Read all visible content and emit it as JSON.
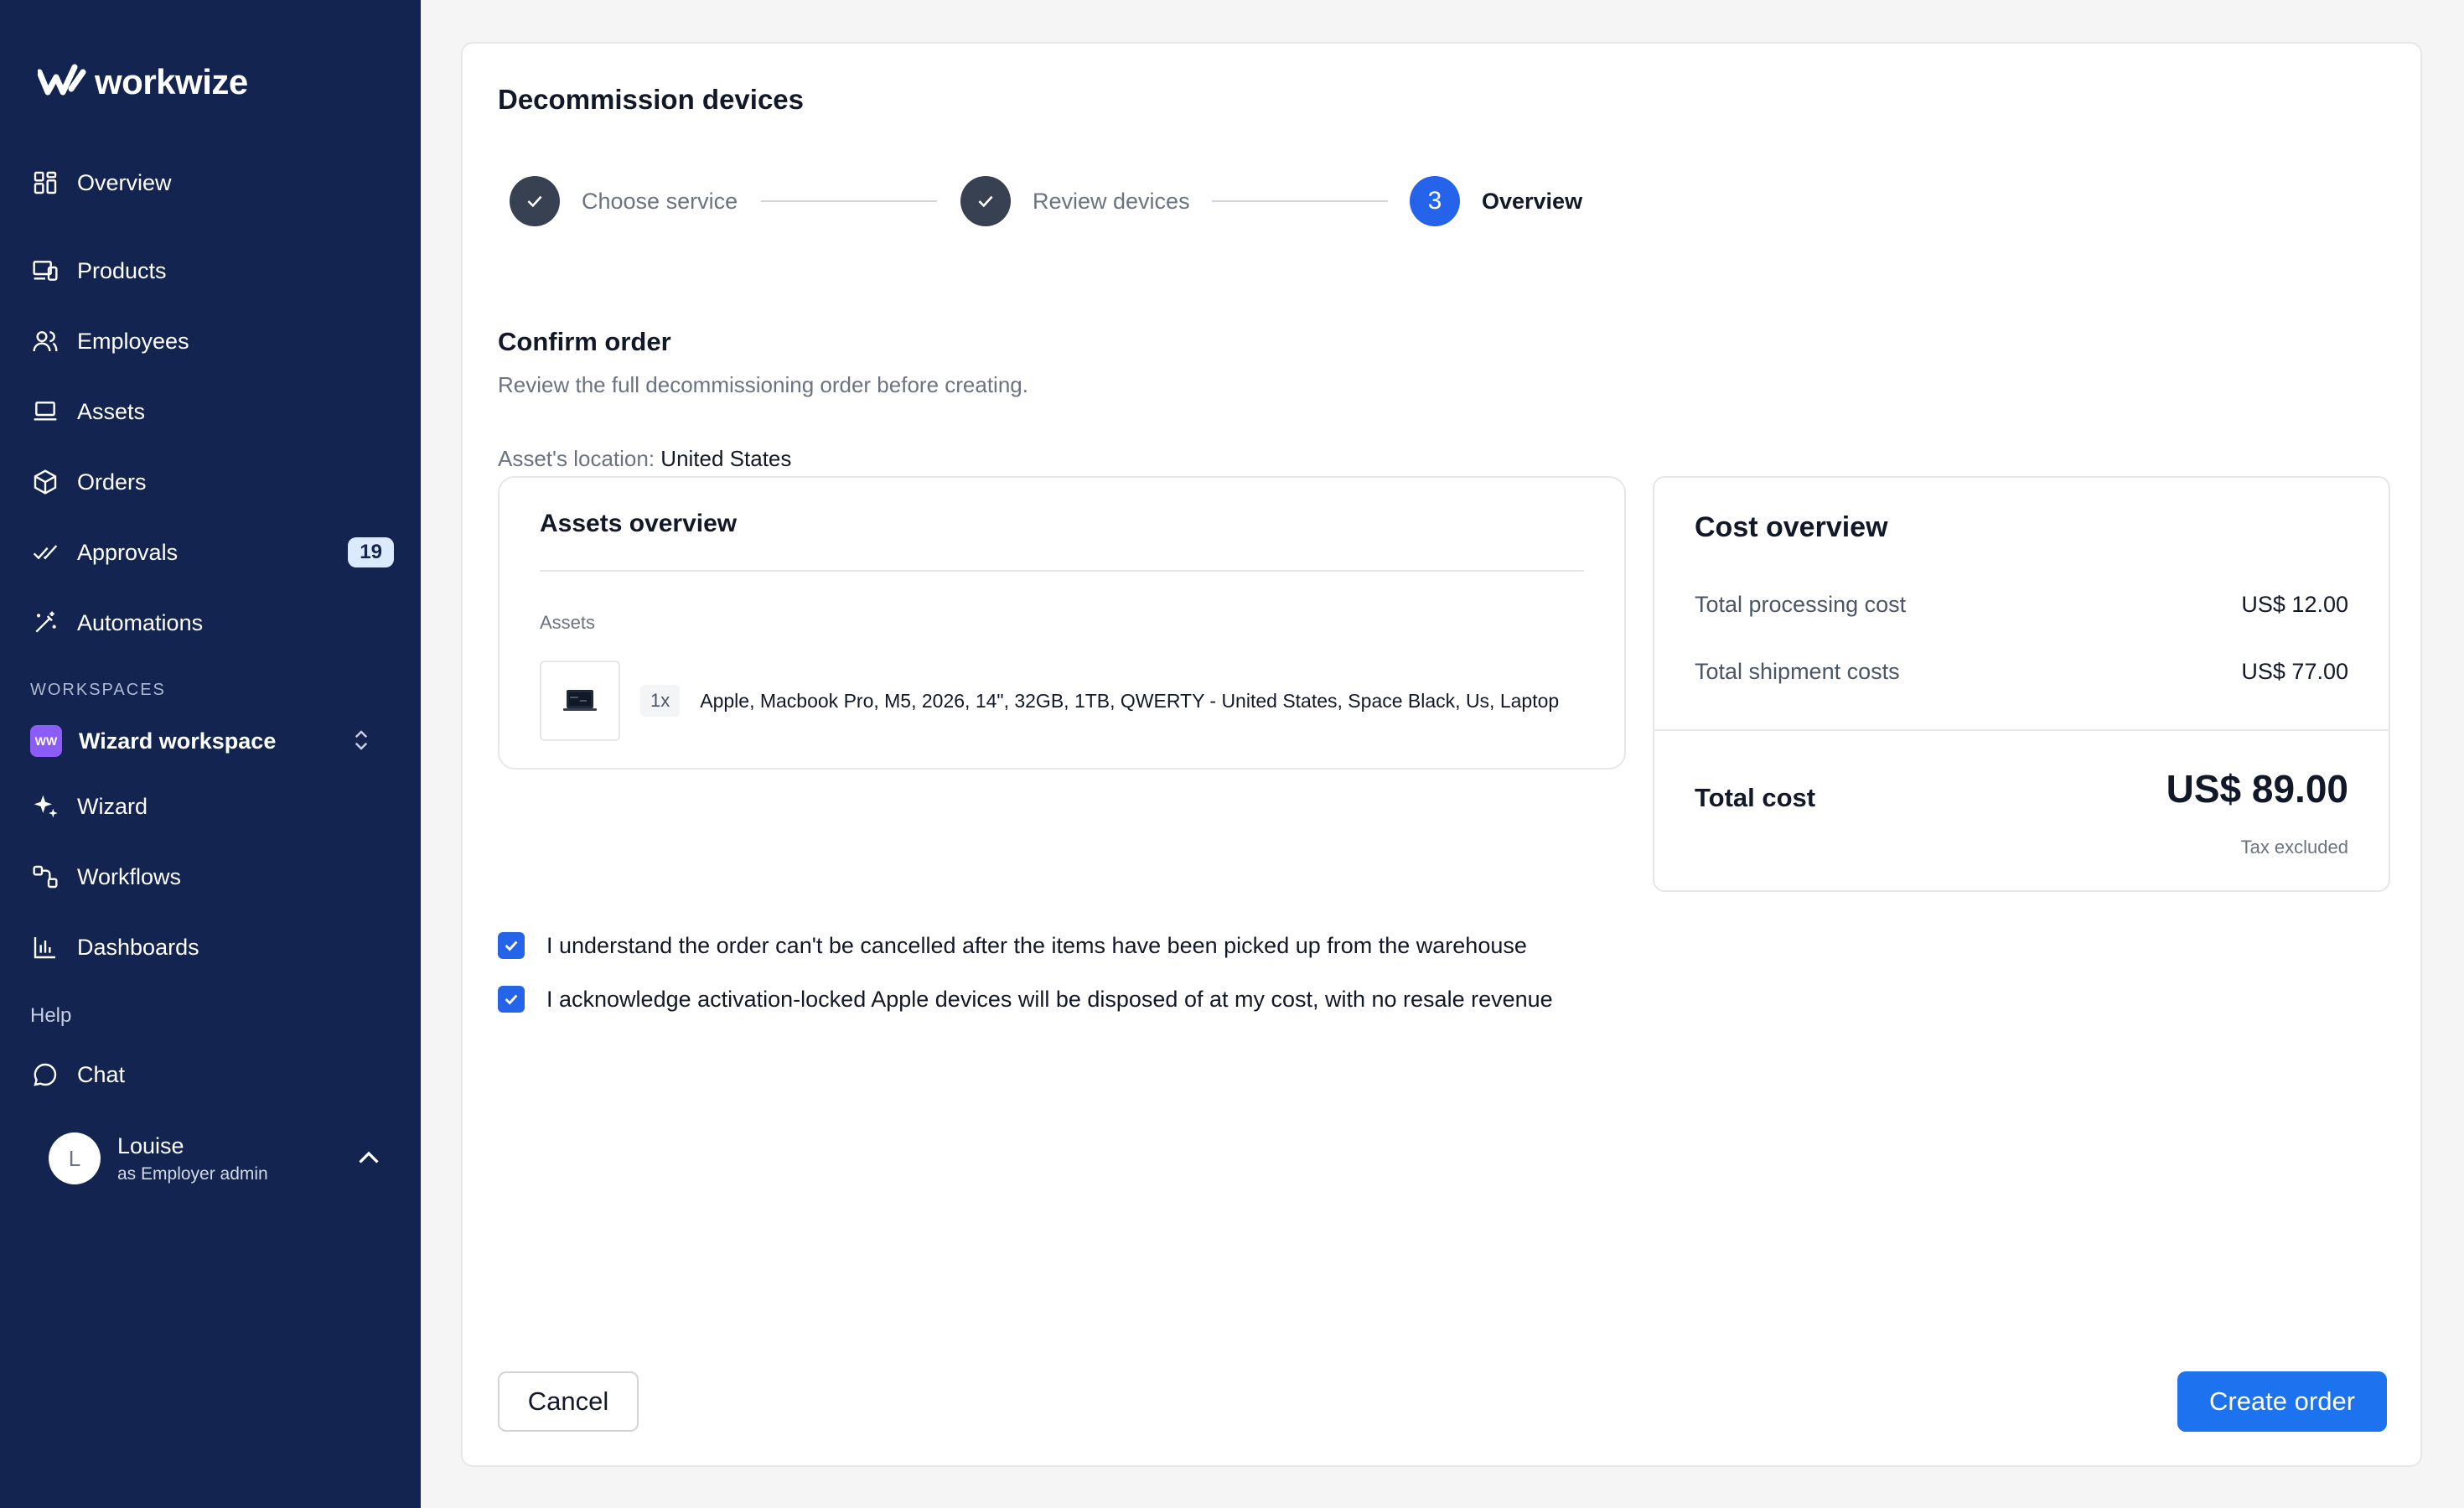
{
  "brand": {
    "name": "workwize",
    "logo_icon": "workwize-logo-icon"
  },
  "sidebar": {
    "items": [
      {
        "label": "Overview",
        "icon": "grid-icon"
      },
      {
        "label": "Products",
        "icon": "devices-icon"
      },
      {
        "label": "Employees",
        "icon": "users-icon"
      },
      {
        "label": "Assets",
        "icon": "laptop-icon"
      },
      {
        "label": "Orders",
        "icon": "box-icon"
      },
      {
        "label": "Approvals",
        "icon": "double-check-icon",
        "badge": "19"
      },
      {
        "label": "Automations",
        "icon": "magic-wand-icon"
      }
    ],
    "workspaces_title": "WORKSPACES",
    "workspace": {
      "initials": "WW",
      "name": "Wizard workspace",
      "color": "#8b5cf6"
    },
    "workspace_items": [
      {
        "label": "Wizard",
        "icon": "sparkle-icon"
      },
      {
        "label": "Workflows",
        "icon": "workflow-icon"
      },
      {
        "label": "Dashboards",
        "icon": "bar-chart-icon"
      }
    ],
    "help_title": "Help",
    "help_items": [
      {
        "label": "Chat",
        "icon": "chat-bubble-icon"
      }
    ],
    "user": {
      "initial": "L",
      "name": "Louise",
      "role": "as Employer admin"
    }
  },
  "main": {
    "title": "Decommission devices",
    "steps": [
      {
        "label": "Choose service",
        "state": "done"
      },
      {
        "label": "Review devices",
        "state": "done"
      },
      {
        "number": "3",
        "label": "Overview",
        "state": "active"
      }
    ],
    "confirm": {
      "title": "Confirm order",
      "subtitle": "Review the full decommissioning order before creating.",
      "location_label": "Asset's location:",
      "location_value": "United States"
    },
    "assets_overview": {
      "title": "Assets overview",
      "section_label": "Assets",
      "items": [
        {
          "qty": "1x",
          "name": "Apple, Macbook Pro, M5, 2026, 14\", 32GB, 1TB, QWERTY - United States, Space Black, Us, Laptop"
        }
      ]
    },
    "cost_overview": {
      "title": "Cost overview",
      "rows": [
        {
          "label": "Total processing cost",
          "value": "US$ 12.00"
        },
        {
          "label": "Total shipment costs",
          "value": "US$ 77.00"
        }
      ],
      "total_label": "Total cost",
      "total_value": "US$ 89.00",
      "tax_note": "Tax excluded"
    },
    "acknowledgements": [
      {
        "text": "I understand the order can't be cancelled after the items have been picked up from the warehouse",
        "checked": true
      },
      {
        "text": "I acknowledge activation-locked Apple devices will be disposed of at my cost, with no resale revenue",
        "checked": true
      }
    ],
    "cancel_label": "Cancel",
    "create_label": "Create order"
  },
  "colors": {
    "sidebar_bg": "#12244f",
    "primary": "#1d72f0",
    "step_done": "#374151",
    "badge_bg": "#dbeafe"
  }
}
